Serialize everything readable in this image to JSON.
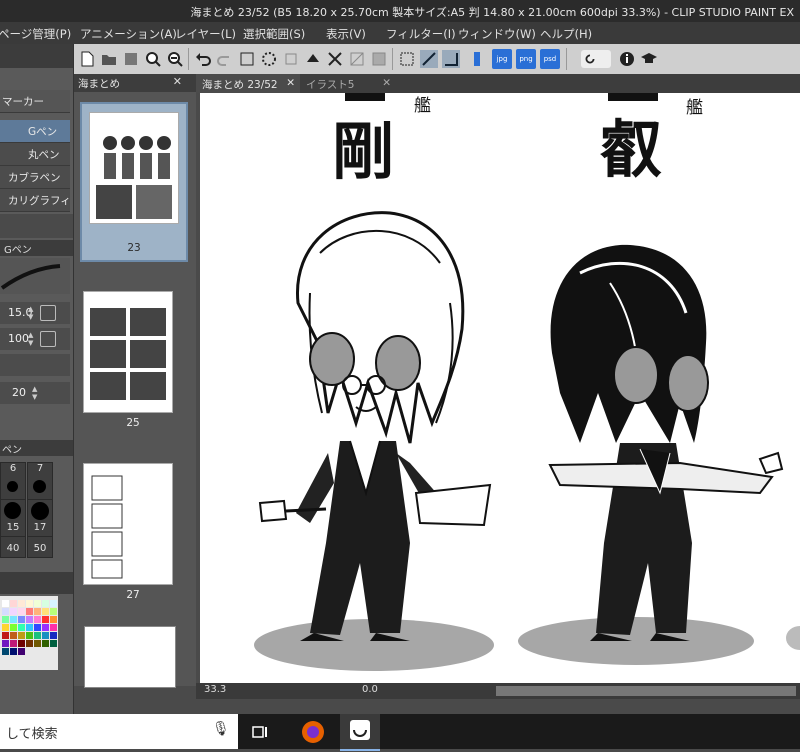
{
  "window": {
    "title": "海まとめ 23/52 (B5 18.20 x 25.70cm 製本サイズ:A5 判 14.80 x 21.00cm 600dpi 33.3%) - CLIP STUDIO PAINT EX"
  },
  "menu": [
    "ページ管理(P)",
    "アニメーション(A)",
    "レイヤー(L)",
    "選択範囲(S)",
    "表示(V)",
    "フィルター(I)",
    "ウィンドウ(W)",
    "ヘルプ(H)"
  ],
  "toolbar": {
    "export_labels": [
      "jpg",
      "png",
      "psd"
    ]
  },
  "tool_panel": {
    "header": "マーカー",
    "subtools": [
      "Gペン",
      "丸ペン",
      "カブラペン",
      "カリグラフィ"
    ],
    "selected_subtool": "Gペン",
    "property_tab": "Gペン",
    "brush_size": "15.0",
    "opacity": "100",
    "stabilization": "20",
    "size_palette_tab": "ペン",
    "sizes": [
      "6",
      "7",
      "15",
      "17",
      "40",
      "50"
    ]
  },
  "page_panel": {
    "tab": "海まとめ",
    "pages": [
      {
        "number": "23",
        "selected": true
      },
      {
        "number": "25",
        "selected": false
      },
      {
        "number": "27",
        "selected": false
      }
    ]
  },
  "document_tabs": [
    {
      "label": "海まとめ  23/52",
      "active": true
    },
    {
      "label": "イラスト5",
      "active": false
    }
  ],
  "canvas": {
    "left_kanji": "剛",
    "left_small": "艦",
    "right_kanji": "叡",
    "right_small": "艦"
  },
  "status": {
    "zoom": "33.3",
    "rotation": "0.0"
  },
  "taskbar": {
    "search_text": "して検索"
  },
  "colors": {
    "accent": "#5e7a99",
    "selected_page": "#9eb3c7",
    "export_button": "#2a6fd6"
  }
}
